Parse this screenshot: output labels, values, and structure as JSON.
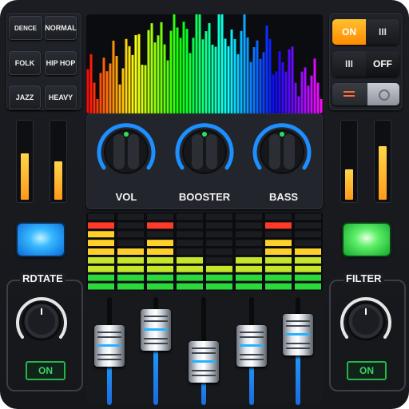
{
  "presets": [
    {
      "id": "dence",
      "label": "DENCE"
    },
    {
      "id": "normal",
      "label": "NORMAL"
    },
    {
      "id": "folk",
      "label": "FOLK"
    },
    {
      "id": "hiphop",
      "label": "HIP HOP"
    },
    {
      "id": "jazz",
      "label": "JAZZ"
    },
    {
      "id": "heavy",
      "label": "HEAVY"
    }
  ],
  "knobs": [
    {
      "label": "VOL"
    },
    {
      "label": "BOOSTER"
    },
    {
      "label": "BASS"
    }
  ],
  "left_meters": [
    0.6,
    0.5
  ],
  "right_meters": [
    0.4,
    0.7
  ],
  "toggle_on": {
    "on_label": "ON",
    "bars_label": "III"
  },
  "toggle_off": {
    "bars_label": "III",
    "off_label": "OFF"
  },
  "rotate": {
    "title": "RDTATE",
    "status": "ON"
  },
  "filter": {
    "title": "FILTER",
    "status": "ON"
  },
  "colors": {
    "accent_orange": "#ff9a1a",
    "led_blue": "#1fa6ff",
    "led_green": "#33e04f",
    "slider_blue": "#25a8ff",
    "status_green": "#3bd36a"
  },
  "eq_levels": [
    7,
    5,
    6,
    4,
    3,
    4,
    6,
    5
  ],
  "eq_peaks": [
    true,
    false,
    true,
    false,
    false,
    false,
    true,
    false
  ],
  "slider_levels": [
    0.55,
    0.7,
    0.4,
    0.55,
    0.65
  ],
  "spectrum_note": ""
}
